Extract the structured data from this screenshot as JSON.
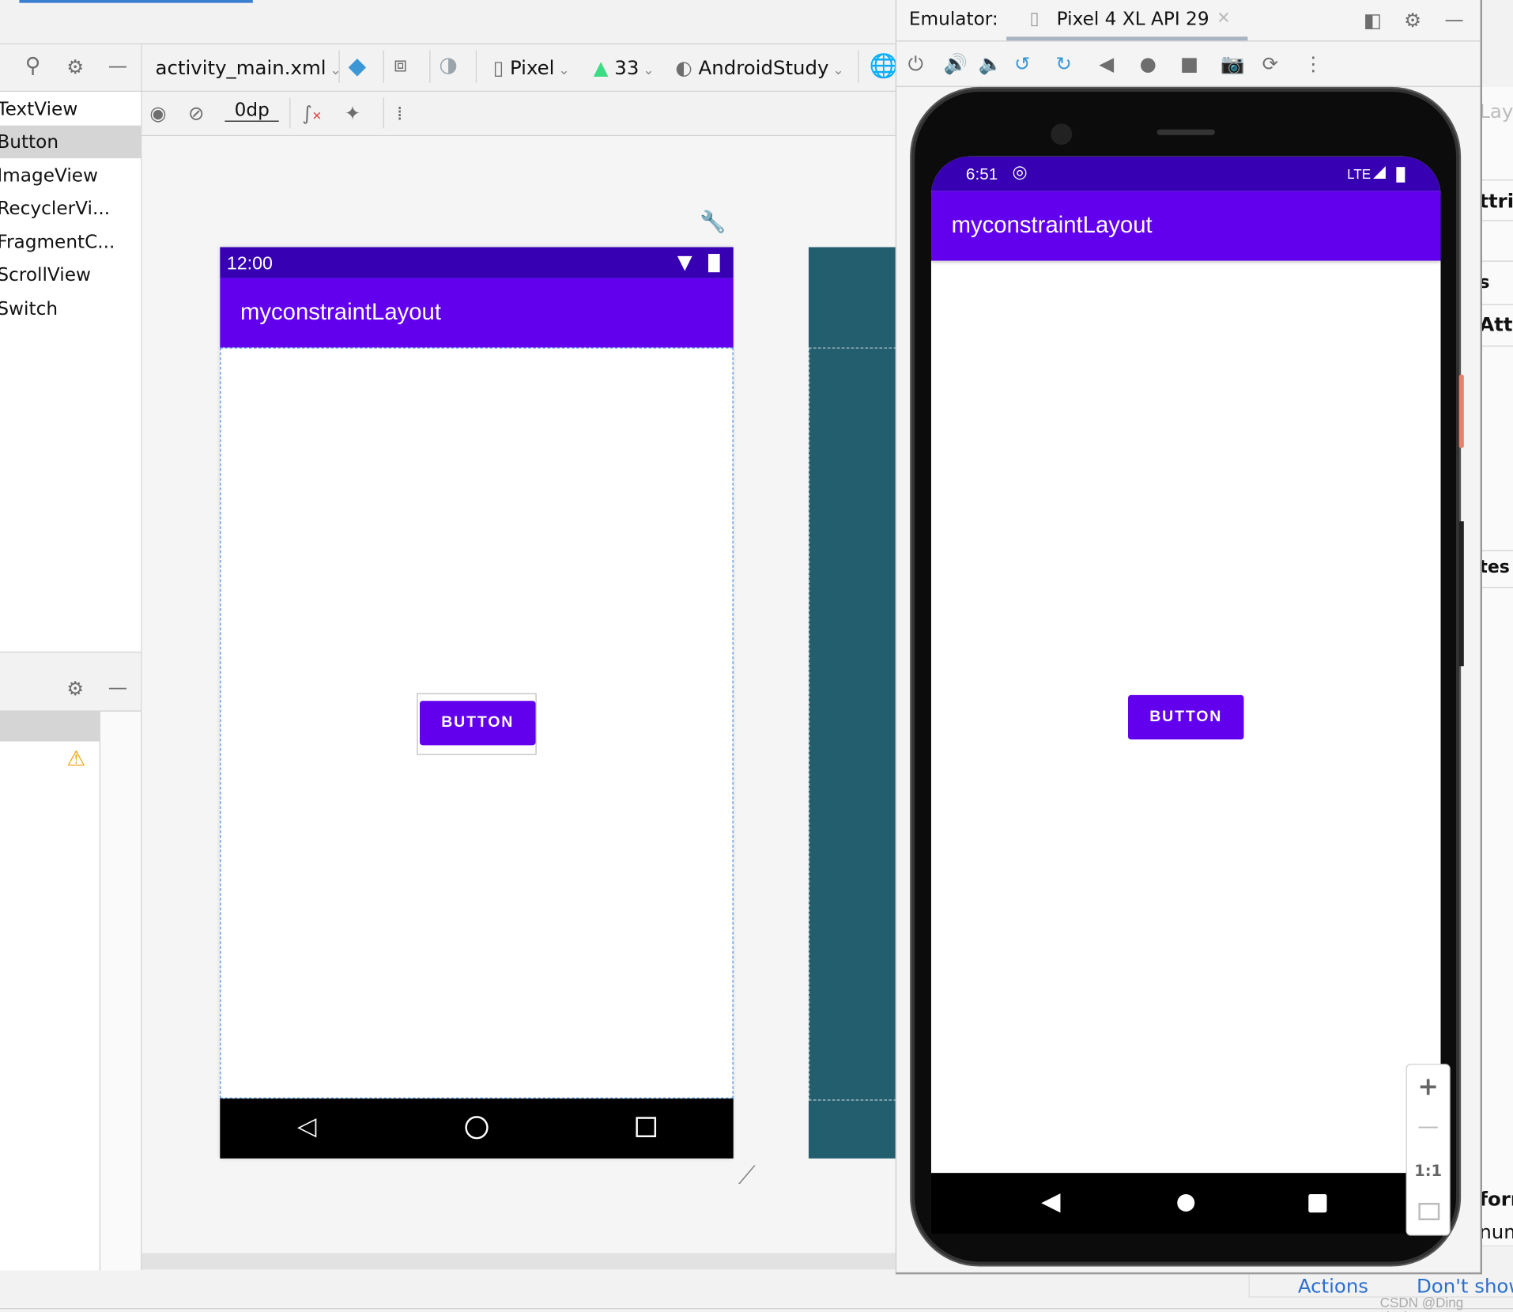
{
  "left_panel": {
    "palette_items": [
      "TextView",
      "Button",
      "ImageView",
      "RecyclerVi...",
      "FragmentC...",
      "ScrollView",
      "Switch"
    ],
    "selected_index": 1
  },
  "toolbar": {
    "file": "activity_main.xml",
    "device": "Pixel",
    "api": "33",
    "theme": "AndroidStudy",
    "margin": "0dp"
  },
  "design_preview": {
    "time": "12:00",
    "app_title": "myconstraintLayout",
    "button_label": "BUTTON"
  },
  "emulator": {
    "label": "Emulator:",
    "tab": "Pixel 4 XL API 29",
    "time": "6:51",
    "network": "LTE",
    "app_title": "myconstraintLayout",
    "button_label": "BUTTON",
    "zoom_actual": "1:1"
  },
  "right_panel": {
    "fragments": [
      "Layo",
      "ttrik",
      "s",
      "Attri",
      "tes",
      "forr",
      "num",
      "how"
    ]
  },
  "notification": {
    "actions": "Actions",
    "dont_show": "Don't show"
  },
  "watermark": "CSDN @Ding Jiaxiong",
  "colors": {
    "primary": "#6200ee",
    "primary_dark": "#3700b3",
    "blueprint": "#235e6f",
    "accent_blue": "#3b8fd6",
    "warning": "#f0a30a"
  }
}
